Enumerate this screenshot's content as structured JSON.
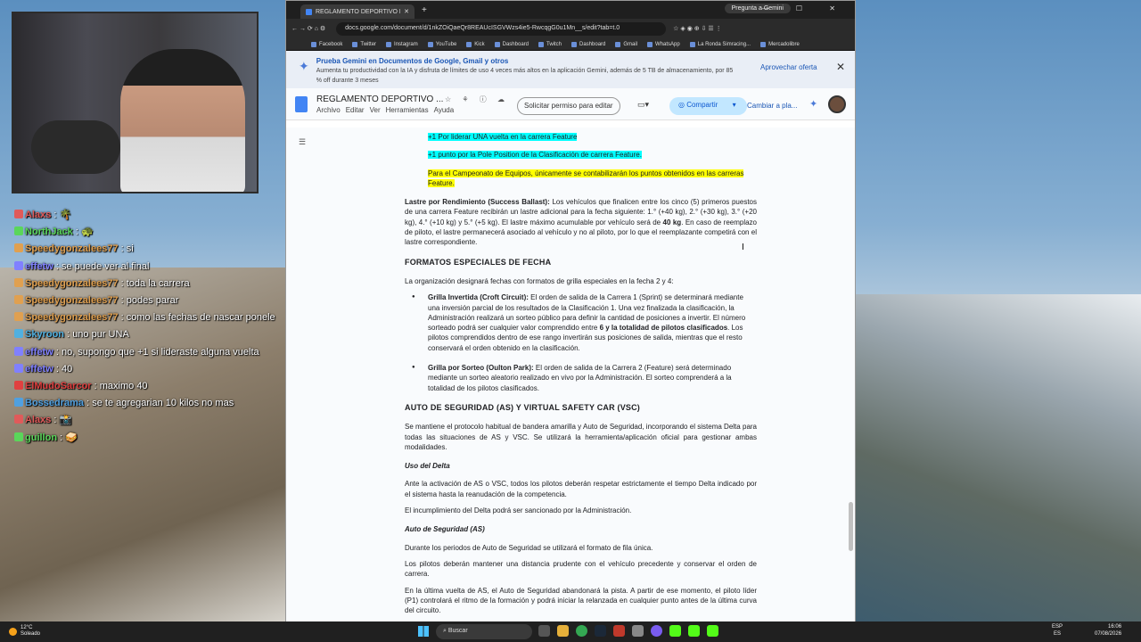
{
  "chat": [
    {
      "user": "Alaxs",
      "msg": ": 🌴",
      "color": "#e05a5a"
    },
    {
      "user": "NorthJack",
      "msg": ": 🐢",
      "color": "#5ad65a"
    },
    {
      "user": "Speedygonzalees77",
      "msg": ": si",
      "color": "#e0a050"
    },
    {
      "user": "effetw",
      "msg": ": se puede ver al final",
      "color": "#8080ff"
    },
    {
      "user": "Speedygonzalees77",
      "msg": ": toda la carrera",
      "color": "#e0a050"
    },
    {
      "user": "Speedygonzalees77",
      "msg": ": podes parar",
      "color": "#e0a050"
    },
    {
      "user": "Speedygonzalees77",
      "msg": ": como las fechas de nascar ponele",
      "color": "#e0a050"
    },
    {
      "user": "Skyroon",
      "msg": ": uno pur UNA",
      "color": "#50b0e0"
    },
    {
      "user": "effetw",
      "msg": ": no, supongo que +1 si lideraste alguna vuelta",
      "color": "#8080ff"
    },
    {
      "user": "effetw",
      "msg": ": 40",
      "color": "#8080ff"
    },
    {
      "user": "ElMudoSarcor",
      "msg": ": maximo 40",
      "color": "#e04040"
    },
    {
      "user": "Bossedrama",
      "msg": ": se te agregarian 10 kilos no mas",
      "color": "#50a0e0"
    },
    {
      "user": "Alaxs",
      "msg": ": 📸",
      "color": "#e05a5a"
    },
    {
      "user": "guillon",
      "msg": ": 🥪",
      "color": "#5ad65a"
    }
  ],
  "browser": {
    "tab_title": "REGLAMENTO DEPORTIVO BTC",
    "tab_plus": "+",
    "gemini_pill": "Pregunta a Gemini",
    "window_controls": "— ☐ ✕",
    "url": "docs.google.com/document/d/1nkZOiQaeQr8REAUcISGVWzs4ie5-RwcqgG0u1Mn__s/edit?tab=t.0",
    "nav": "← → ⟳ ⌂ ⚙",
    "bookmarks": [
      "Facebook",
      "Twitter",
      "Instagram",
      "YouTube",
      "Kick",
      "Dashboard",
      "Twitch",
      "Dashboard",
      "Gmail",
      "WhatsApp",
      "La Ronda Simracing...",
      "Mercadolibre"
    ]
  },
  "promo": {
    "title": "Prueba Gemini en Documentos de Google, Gmail y otros",
    "body": "Aumenta tu productividad con la IA y disfruta de límites de uso 4 veces más altos en la aplicación Gemini, además de 5 TB de almacenamiento, por 85 % off durante 3 meses",
    "action": "Aprovechar oferta",
    "close": "✕"
  },
  "docbar": {
    "title": "REGLAMENTO DEPORTIVO ...",
    "menus": [
      "Archivo",
      "Editar",
      "Ver",
      "Herramientas",
      "Ayuda"
    ],
    "title_icons": "☆ ⚘ ⓘ ☁",
    "request_button": "Solicitar permiso para editar",
    "video_icon": "▭▾",
    "share_button": "Compartir",
    "share_caret": "▾",
    "change_button": "Cambiar a pla...",
    "gemini_icon": "✦"
  },
  "document": {
    "outline_icon": "☰",
    "hl1": "+1 Por liderar UNA vuelta en la carrera Feature",
    "hl2": "+1 punto por la Pole Position de la Clasificación de carrera Feature.",
    "hl3": "Para el Campeonato de Equipos, únicamente se contabilizarán los puntos obtenidos en las carreras Feature.",
    "ballast_label": "Lastre por Rendimiento (Success Ballast):",
    "ballast_text_a": " Los vehículos que finalicen entre los cinco (5) primeros puestos de una carrera Feature recibirán un lastre adicional para la fecha siguiente: 1.° (+40 kg), 2.° (+30 kg), 3.° (+20 kg), 4.° (+10 kg) y 5.° (+5 kg). El lastre máximo acumulable por vehículo será de ",
    "ballast_bold": "40 kg",
    "ballast_text_b": ". En caso de reemplazo de piloto, el lastre permanecerá asociado al vehículo y no al piloto, por lo que el reemplazante competirá con el lastre correspondiente.",
    "h_formatos": "FORMATOS ESPECIALES DE FECHA",
    "p_formatos": "La organización designará fechas con formatos de grilla especiales en la fecha 2 y 4:",
    "b1_label": "Grilla Invertida (Croft Circuit):",
    "b1_text_a": " El orden de salida de la Carrera 1 (Sprint) se determinará mediante una inversión parcial de los resultados de la Clasificación 1. Una vez finalizada la clasificación, la Administración realizará un sorteo público para definir la cantidad de posiciones a invertir. El número sorteado podrá ser cualquier valor comprendido entre ",
    "b1_bold": "6 y la totalidad de pilotos clasificados",
    "b1_text_b": ". Los pilotos comprendidos dentro de ese rango invertirán sus posiciones de salida, mientras que el resto conservará el orden obtenido en la clasificación.",
    "b2_label": "Grilla por Sorteo (Oulton Park):",
    "b2_text": " El orden de salida de la Carrera 2 (Feature) será determinado mediante un sorteo aleatorio realizado en vivo por la Administración. El sorteo comprenderá a la totalidad de los pilotos clasificados.",
    "h_as": "AUTO DE SEGURIDAD (AS) Y VIRTUAL SAFETY CAR (VSC)",
    "p_as": "Se mantiene el protocolo habitual de bandera amarilla y Auto de Seguridad, incorporando el sistema Delta para todas las situaciones de AS y VSC. Se utilizará la herramienta/aplicación oficial para gestionar ambas modalidades.",
    "h_delta": "Uso del Delta",
    "p_delta1": "Ante la activación de AS o VSC, todos los pilotos deberán respetar estrictamente el tiempo Delta indicado por el sistema hasta la reanudación de la competencia.",
    "p_delta2": "El incumplimiento del Delta podrá ser sancionado por la Administración.",
    "h_auto": "Auto de Seguridad (AS)",
    "p_auto1": "Durante los periodos de Auto de Seguridad se utilizará el formato de fila única.",
    "p_auto2": "Los pilotos deberán mantener una distancia prudente con el vehículo precedente y conservar el orden de carrera.",
    "p_auto3": "En la última vuelta de AS, el Auto de Seguridad abandonará la pista. A partir de ese momento, el piloto líder (P1) controlará el ritmo de la formación y podrá iniciar la relanzada en cualquier punto antes de la última curva del circuito."
  },
  "taskbar": {
    "temp": "12°C",
    "weather": "Soleado",
    "search": "Buscar",
    "lang1": "ESP",
    "lang2": "ES",
    "time": "16:06",
    "date": "07/08/2026"
  }
}
